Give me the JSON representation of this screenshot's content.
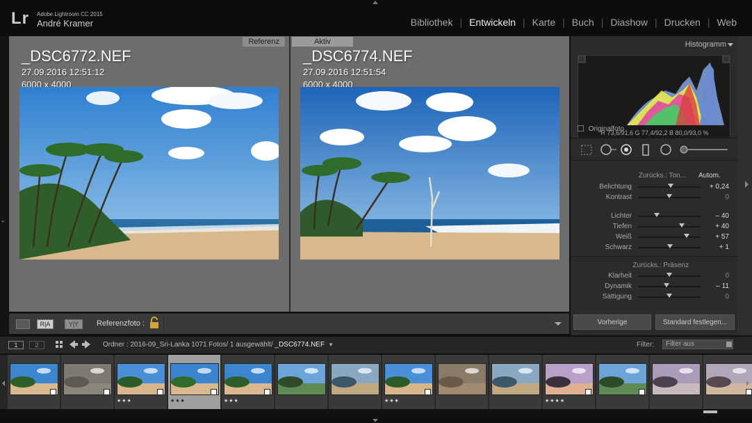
{
  "app": {
    "logo": "Lr",
    "name": "Adobe Lightroom CC 2015",
    "user": "André Kramer"
  },
  "modules": [
    {
      "label": "Bibliothek",
      "active": false
    },
    {
      "label": "Entwickeln",
      "active": true
    },
    {
      "label": "Karte",
      "active": false
    },
    {
      "label": "Buch",
      "active": false
    },
    {
      "label": "Diashow",
      "active": false
    },
    {
      "label": "Drucken",
      "active": false
    },
    {
      "label": "Web",
      "active": false
    }
  ],
  "compare": {
    "reference": {
      "label": "Referenz",
      "file": "_DSC6772.NEF",
      "date": "27.09.2016 12:51:12",
      "size": "6000 x 4000"
    },
    "active": {
      "label": "Aktiv",
      "file": "_DSC6774.NEF",
      "date": "27.09.2016 12:51:54",
      "size": "6000 x 4000"
    }
  },
  "toolbar": {
    "referenzfoto_label": "Referenzfoto :",
    "ab_label": "R|A",
    "yy_label": "Y|Y"
  },
  "panel": {
    "histogram_title": "Histogramm",
    "histogram_values": "R  73,6/91,6   G  77,4/92,2   B  80,0/93,0  %",
    "original_label": "Originalfoto",
    "tone_reset": "Zurücks.: Ton...",
    "auto_label": "Autom.",
    "presence_reset": "Zurücks.: Präsenz",
    "sliders_tone": [
      {
        "label": "Belichtung",
        "value": "+ 0,24",
        "pos": 0.52
      },
      {
        "label": "Kontrast",
        "value": "0",
        "pos": 0.5
      },
      {
        "label": "Lichter",
        "value": "– 40",
        "pos": 0.3
      },
      {
        "label": "Tiefen",
        "value": "+ 40",
        "pos": 0.7
      },
      {
        "label": "Weiß",
        "value": "+ 57",
        "pos": 0.78
      },
      {
        "label": "Schwarz",
        "value": "+ 1",
        "pos": 0.51
      }
    ],
    "sliders_presence": [
      {
        "label": "Klarheit",
        "value": "0",
        "pos": 0.5
      },
      {
        "label": "Dynamik",
        "value": "– 11",
        "pos": 0.45
      },
      {
        "label": "Sättigung",
        "value": "0",
        "pos": 0.5
      }
    ],
    "prev_button": "Vorherige",
    "default_button": "Standard festlegen..."
  },
  "filmbar": {
    "screen1": "1",
    "screen2": "2",
    "folder_text": "Ordner : 2016-09_Sri-Lanka    1071 Fotos/ 1 ausgewählt/",
    "current_file": " _DSC6774.NEF",
    "filter_label": "Filter:",
    "filter_value": "Filter aus"
  },
  "filmstrip": [
    {
      "stars": "",
      "kind": "beach1",
      "selected": false,
      "badge": true
    },
    {
      "stars": "",
      "kind": "sand",
      "selected": false,
      "badge": true
    },
    {
      "stars": "★★★",
      "kind": "palms",
      "selected": false,
      "badge": true
    },
    {
      "stars": "★★★",
      "kind": "beach2",
      "selected": true,
      "badge": true
    },
    {
      "stars": "★★★",
      "kind": "beach1",
      "selected": false,
      "badge": true
    },
    {
      "stars": "",
      "kind": "palms2",
      "selected": false,
      "badge": false
    },
    {
      "stars": "",
      "kind": "coast",
      "selected": false,
      "badge": false
    },
    {
      "stars": "★★★",
      "kind": "palms",
      "selected": false,
      "badge": true
    },
    {
      "stars": "",
      "kind": "sand2",
      "selected": false,
      "badge": false
    },
    {
      "stars": "",
      "kind": "coast",
      "selected": false,
      "badge": false
    },
    {
      "stars": "★★★★",
      "kind": "sunset",
      "selected": false,
      "badge": true
    },
    {
      "stars": "",
      "kind": "palms2",
      "selected": false,
      "badge": true
    },
    {
      "stars": "",
      "kind": "dusk",
      "selected": false,
      "badge": false
    },
    {
      "stars": "",
      "kind": "dusk2",
      "selected": false,
      "badge": true
    }
  ]
}
